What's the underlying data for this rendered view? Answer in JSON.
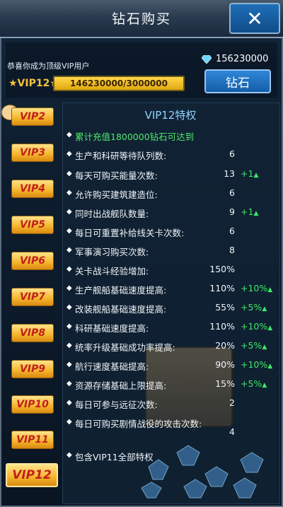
{
  "window": {
    "title": "钻石购买",
    "close_icon": "close-icon"
  },
  "account": {
    "congrats": "恭喜你成为顶级VIP用户",
    "diamonds": "156230000",
    "vip_label": "★VIP12★",
    "progress_text": "146230000/3000000",
    "progress_fraction": 1.0,
    "buy_button": "钻石"
  },
  "tabs": [
    "VIP2",
    "VIP3",
    "VIP4",
    "VIP5",
    "VIP6",
    "VIP7",
    "VIP8",
    "VIP9",
    "VIP10",
    "VIP11",
    "VIP12"
  ],
  "active_tab": "VIP12",
  "panel": {
    "title": "VIP12特权",
    "rows": [
      {
        "label": "累计充值1800000钻石可达到",
        "value": "",
        "inc": "",
        "green": true
      },
      {
        "label": "生产和科研等待队列数:",
        "value": "6",
        "inc": ""
      },
      {
        "label": "每天可购买能量次数:",
        "value": "13",
        "inc": "+1"
      },
      {
        "label": "允许购买建筑建造位:",
        "value": "6",
        "inc": ""
      },
      {
        "label": "同时出战舰队数量:",
        "value": "9",
        "inc": "+1"
      },
      {
        "label": "每日可重置补给线关卡次数:",
        "value": "6",
        "inc": ""
      },
      {
        "label": "军事演习购买次数:",
        "value": "8",
        "inc": ""
      },
      {
        "label": "关卡战斗经验增加:",
        "value": "150%",
        "inc": ""
      },
      {
        "label": "生产舰船基础速度提高:",
        "value": "110%",
        "inc": "+10%"
      },
      {
        "label": "改装舰船基础速度提高:",
        "value": "55%",
        "inc": "+5%"
      },
      {
        "label": "科研基础速度提高:",
        "value": "110%",
        "inc": "+10%"
      },
      {
        "label": "统率升级基础成功率提高:",
        "value": "20%",
        "inc": "+5%"
      },
      {
        "label": "航行速度基础提高:",
        "value": "90%",
        "inc": "+10%"
      },
      {
        "label": "资源存储基础上限提高:",
        "value": "15%",
        "inc": "+5%"
      },
      {
        "label": "每日可参与远征次数:",
        "value": "2",
        "inc": ""
      },
      {
        "label": "每日可购买剧情战役的攻击次数:",
        "value": "4",
        "inc": ""
      },
      {
        "label": "包含VIP11全部特权",
        "value": "",
        "inc": ""
      }
    ]
  },
  "colors": {
    "accent_gold": "#f5b42a",
    "accent_blue": "#1f6fb7",
    "increase_green": "#3fe86a"
  }
}
